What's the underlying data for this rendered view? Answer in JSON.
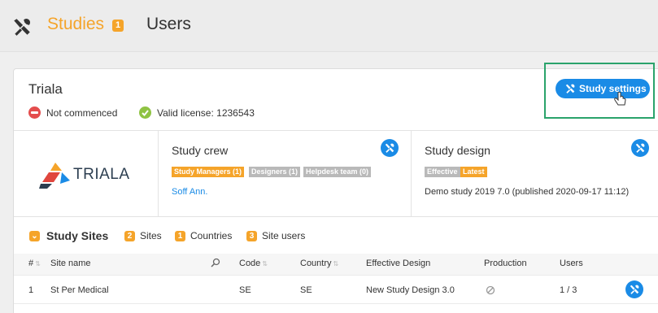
{
  "nav": {
    "studies_label": "Studies",
    "studies_badge": "1",
    "users_label": "Users"
  },
  "study": {
    "title": "Triala",
    "status_not_commenced": "Not commenced",
    "license": "Valid license: 1236543",
    "settings_label": "Study settings"
  },
  "logo_text": "TRIALA",
  "crew": {
    "title": "Study crew",
    "tags": [
      "Study Managers (1)",
      "Designers (1)",
      "Helpdesk team (0)"
    ],
    "member": "Soff Ann."
  },
  "design": {
    "title": "Study design",
    "tags": [
      "Effective",
      "Latest"
    ],
    "description": "Demo study 2019 7.0 (published 2020-09-17 11:12)"
  },
  "sites": {
    "title": "Study Sites",
    "sites_count": "2",
    "sites_label": "Sites",
    "countries_count": "1",
    "countries_label": "Countries",
    "users_count": "3",
    "users_label": "Site users",
    "columns": [
      "#",
      "Site name",
      "Code",
      "Country",
      "Effective Design",
      "Production",
      "Users"
    ],
    "rows": [
      {
        "num": "1",
        "name": "St Per Medical",
        "code": "SE",
        "country": "SE",
        "design": "New Study Design 3.0",
        "users": "1 / 3"
      }
    ]
  },
  "colors": {
    "accent_orange": "#f5a42a",
    "primary_blue": "#1a8be6",
    "highlight_green": "#2aa36b"
  }
}
